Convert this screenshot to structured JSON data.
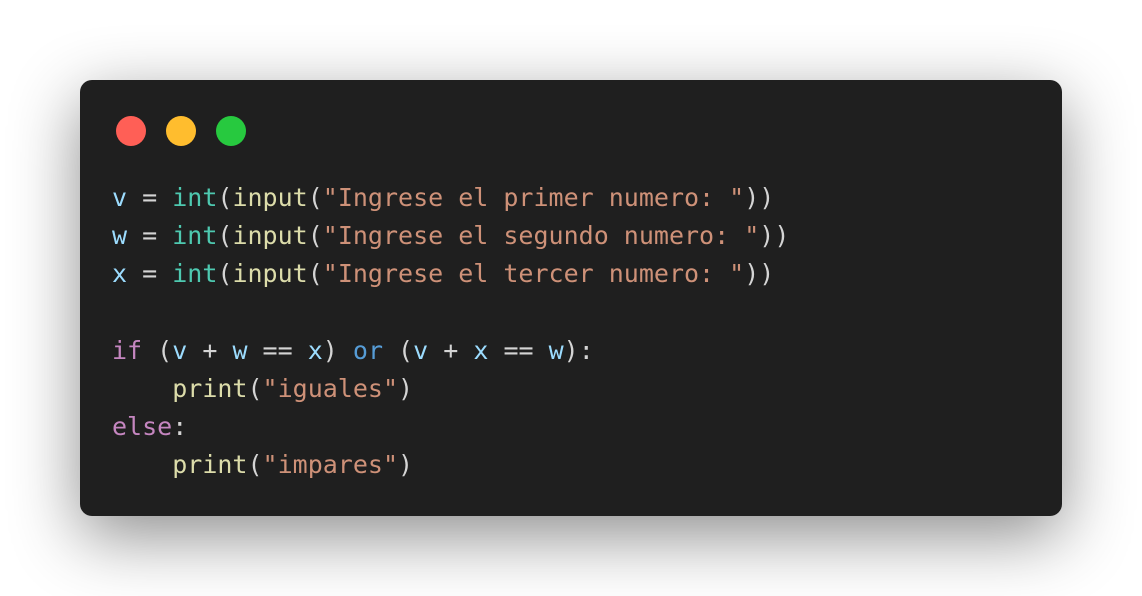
{
  "window": {
    "controls": {
      "close_color": "#ff5f56",
      "minimize_color": "#ffbd2e",
      "maximize_color": "#27c93f"
    }
  },
  "code": {
    "language": "python",
    "lines": [
      [
        {
          "t": "v",
          "c": "var"
        },
        {
          "t": " = ",
          "c": "punct"
        },
        {
          "t": "int",
          "c": "builtin"
        },
        {
          "t": "(",
          "c": "punct"
        },
        {
          "t": "input",
          "c": "func"
        },
        {
          "t": "(",
          "c": "punct"
        },
        {
          "t": "\"Ingrese el primer numero: \"",
          "c": "str"
        },
        {
          "t": "))",
          "c": "punct"
        }
      ],
      [
        {
          "t": "w",
          "c": "var"
        },
        {
          "t": " = ",
          "c": "punct"
        },
        {
          "t": "int",
          "c": "builtin"
        },
        {
          "t": "(",
          "c": "punct"
        },
        {
          "t": "input",
          "c": "func"
        },
        {
          "t": "(",
          "c": "punct"
        },
        {
          "t": "\"Ingrese el segundo numero: \"",
          "c": "str"
        },
        {
          "t": "))",
          "c": "punct"
        }
      ],
      [
        {
          "t": "x",
          "c": "var"
        },
        {
          "t": " = ",
          "c": "punct"
        },
        {
          "t": "int",
          "c": "builtin"
        },
        {
          "t": "(",
          "c": "punct"
        },
        {
          "t": "input",
          "c": "func"
        },
        {
          "t": "(",
          "c": "punct"
        },
        {
          "t": "\"Ingrese el tercer numero: \"",
          "c": "str"
        },
        {
          "t": "))",
          "c": "punct"
        }
      ],
      [],
      [
        {
          "t": "if",
          "c": "kw"
        },
        {
          "t": " (",
          "c": "punct"
        },
        {
          "t": "v",
          "c": "var"
        },
        {
          "t": " + ",
          "c": "punct"
        },
        {
          "t": "w",
          "c": "var"
        },
        {
          "t": " == ",
          "c": "punct"
        },
        {
          "t": "x",
          "c": "var"
        },
        {
          "t": ") ",
          "c": "punct"
        },
        {
          "t": "or",
          "c": "op-kw"
        },
        {
          "t": " (",
          "c": "punct"
        },
        {
          "t": "v",
          "c": "var"
        },
        {
          "t": " + ",
          "c": "punct"
        },
        {
          "t": "x",
          "c": "var"
        },
        {
          "t": " == ",
          "c": "punct"
        },
        {
          "t": "w",
          "c": "var"
        },
        {
          "t": "):",
          "c": "punct"
        }
      ],
      [
        {
          "t": "    ",
          "c": "punct"
        },
        {
          "t": "print",
          "c": "func"
        },
        {
          "t": "(",
          "c": "punct"
        },
        {
          "t": "\"iguales\"",
          "c": "str"
        },
        {
          "t": ")",
          "c": "punct"
        }
      ],
      [
        {
          "t": "else",
          "c": "kw"
        },
        {
          "t": ":",
          "c": "punct"
        }
      ],
      [
        {
          "t": "    ",
          "c": "punct"
        },
        {
          "t": "print",
          "c": "func"
        },
        {
          "t": "(",
          "c": "punct"
        },
        {
          "t": "\"impares\"",
          "c": "str"
        },
        {
          "t": ")",
          "c": "punct"
        }
      ]
    ]
  }
}
